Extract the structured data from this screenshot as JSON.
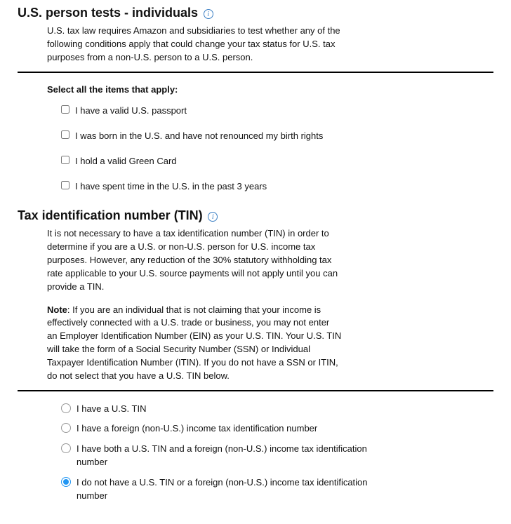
{
  "section1": {
    "title": "U.S. person tests - individuals",
    "desc": "U.S. tax law requires Amazon and subsidiaries to test whether any of the following conditions apply that could change your tax status for U.S. tax purposes from a non-U.S. person to a U.S. person.",
    "subheading": "Select all the items that apply:",
    "options": [
      "I have a valid U.S. passport",
      "I was born in the U.S. and have not renounced my birth rights",
      "I hold a valid Green Card",
      "I have spent time in the U.S. in the past 3 years"
    ]
  },
  "section2": {
    "title": "Tax identification number (TIN)",
    "desc": "It is not necessary to have a tax identification number (TIN) in order to determine if you are a U.S. or non-U.S. person for U.S. income tax purposes. However, any reduction of the 30% statutory withholding tax rate applicable to your U.S. source payments will not apply until you can provide a TIN.",
    "note_label": "Note",
    "note_text": ": If you are an individual that is not claiming that your income is effectively connected with a U.S. trade or business, you may not enter an Employer Identification Number (EIN) as your U.S. TIN. Your U.S. TIN will take the form of a Social Security Number (SSN) or Individual Taxpayer Identification Number (ITIN). If you do not have a SSN or ITIN, do not select that you have a U.S. TIN below.",
    "options": [
      {
        "label": "I have a U.S. TIN",
        "selected": false
      },
      {
        "label": "I have a foreign (non-U.S.) income tax identification number",
        "selected": false
      },
      {
        "label": "I have both a U.S. TIN and a foreign (non-U.S.) income tax identification number",
        "selected": false
      },
      {
        "label": "I do not have a U.S. TIN or a foreign (non-U.S.) income tax identification number",
        "selected": true
      }
    ]
  }
}
